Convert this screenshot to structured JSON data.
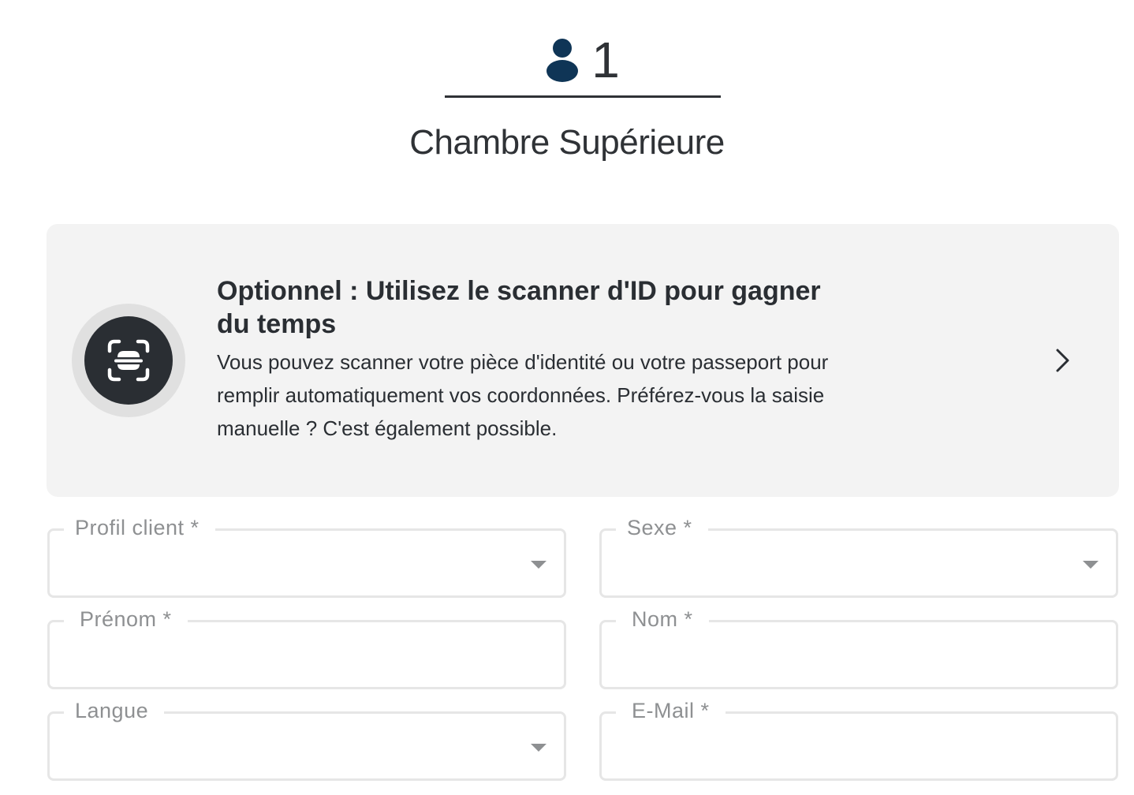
{
  "guest": {
    "count": "1",
    "icon": "person-icon",
    "room_name": "Chambre Supérieure"
  },
  "scanner_card": {
    "icon": "id-scan-icon",
    "title": "Optionnel : Utilisez le scanner d'ID pour gagner du temps",
    "body": "Vous pouvez scanner votre pièce d'identité ou votre passeport pour remplir automatiquement vos coordonnées. Préférez-vous la saisie manuelle ? C'est également possible.",
    "chevron_icon": "chevron-right-icon"
  },
  "form": {
    "profile_label": "Profil client *",
    "profile_value": "",
    "sex_label": "Sexe *",
    "sex_value": "",
    "first_name_label": "Prénom *",
    "first_name_value": "",
    "last_name_label": "Nom *",
    "last_name_value": "",
    "language_label": "Langue",
    "language_value": "",
    "email_label": "E-Mail *",
    "email_value": ""
  },
  "colors": {
    "primary_dark": "#0f3556",
    "card_background": "#f3f3f3",
    "border": "#e6e6e6",
    "label": "#8e9092"
  }
}
